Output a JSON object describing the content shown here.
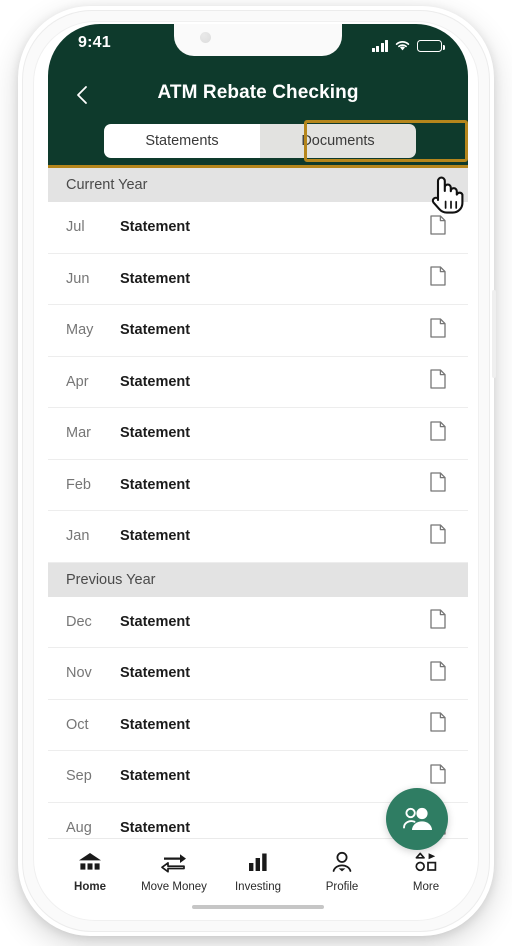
{
  "status_bar": {
    "time": "9:41",
    "icons": [
      "signal-icon",
      "wifi-icon",
      "battery-icon"
    ]
  },
  "header": {
    "title": "ATM Rebate Checking",
    "back_icon": "chevron-left-icon",
    "background_color": "#0E3A2C",
    "accent_color": "#B5861C"
  },
  "tabs": {
    "items": [
      {
        "label": "Statements",
        "selected": false
      },
      {
        "label": "Documents",
        "selected": true
      }
    ],
    "focused": "Documents"
  },
  "cursor": {
    "type": "pointing-hand-cursor"
  },
  "sections": [
    {
      "title": "Current Year",
      "rows": [
        {
          "month": "Jul",
          "label": "Statement",
          "icon": "document-icon"
        },
        {
          "month": "Jun",
          "label": "Statement",
          "icon": "document-icon"
        },
        {
          "month": "May",
          "label": "Statement",
          "icon": "document-icon"
        },
        {
          "month": "Apr",
          "label": "Statement",
          "icon": "document-icon"
        },
        {
          "month": "Mar",
          "label": "Statement",
          "icon": "document-icon"
        },
        {
          "month": "Feb",
          "label": "Statement",
          "icon": "document-icon"
        },
        {
          "month": "Jan",
          "label": "Statement",
          "icon": "document-icon"
        }
      ]
    },
    {
      "title": "Previous Year",
      "rows": [
        {
          "month": "Dec",
          "label": "Statement",
          "icon": "document-icon"
        },
        {
          "month": "Nov",
          "label": "Statement",
          "icon": "document-icon"
        },
        {
          "month": "Oct",
          "label": "Statement",
          "icon": "document-icon"
        },
        {
          "month": "Sep",
          "label": "Statement",
          "icon": "document-icon"
        },
        {
          "month": "Aug",
          "label": "Statement",
          "icon": "document-icon"
        }
      ]
    }
  ],
  "fab": {
    "icon": "people-icon",
    "color": "#2F7D63"
  },
  "bottom_nav": {
    "items": [
      {
        "label": "Home",
        "icon": "bank-home-icon",
        "active": true
      },
      {
        "label": "Move Money",
        "icon": "transfer-icon",
        "active": false
      },
      {
        "label": "Investing",
        "icon": "bar-chart-icon",
        "active": false
      },
      {
        "label": "Profile",
        "icon": "person-icon",
        "active": false
      },
      {
        "label": "More",
        "icon": "grid-shapes-icon",
        "active": false
      }
    ]
  }
}
